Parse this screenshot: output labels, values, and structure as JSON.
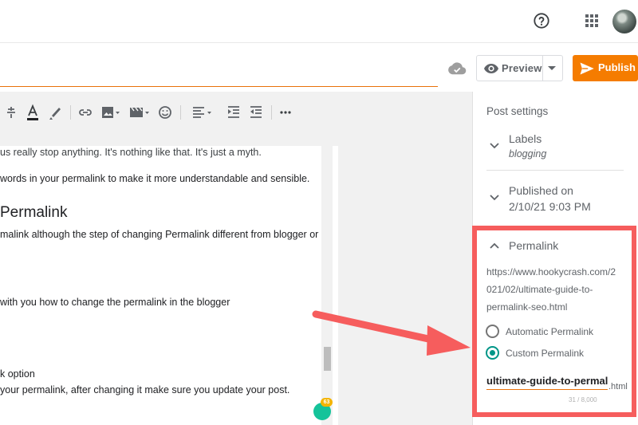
{
  "header": {
    "help_icon": "help-circle-icon",
    "apps_icon": "apps-grid-icon",
    "avatar": "user-avatar"
  },
  "title_bar": {
    "save_status_icon": "cloud-done-icon",
    "preview_label": "Preview",
    "publish_label": "Publish",
    "accent_color": "#f57c00"
  },
  "toolbar": {
    "items": [
      "strikethrough-icon",
      "text-color-icon",
      "highlight-icon",
      "link-icon",
      "image-icon",
      "video-icon",
      "emoji-icon",
      "align-icon",
      "indent-icon",
      "outdent-icon",
      "more-icon"
    ]
  },
  "editor": {
    "lines": [
      "us really stop anything. It's nothing like that. It's just a myth.",
      "words in your permalink to make it more understandable and sensible.",
      "Permalink",
      "malink although the step of changing Permalink different from blogger or",
      "with you how to change the permalink in the blogger",
      "k option",
      "your permalink, after changing it make sure you update your post."
    ],
    "grammar_count": "63"
  },
  "sidebar": {
    "title": "Post settings",
    "labels": {
      "label": "Labels",
      "value": "blogging"
    },
    "published": {
      "label": "Published on",
      "value": "2/10/21 9:03 PM"
    },
    "permalink": {
      "label": "Permalink",
      "url_lines": [
        "https://www.hookycrash.com/2",
        "021/02/ultimate-guide-to-",
        "permalink-seo.html"
      ],
      "options": [
        {
          "label": "Automatic Permalink",
          "selected": false
        },
        {
          "label": "Custom Permalink",
          "selected": true
        }
      ],
      "slug_value": "ultimate-guide-to-permalink-seo",
      "slug_suffix": ".html",
      "char_count": "31 / 8,000"
    }
  },
  "annotation": {
    "color": "#f65d5d"
  }
}
